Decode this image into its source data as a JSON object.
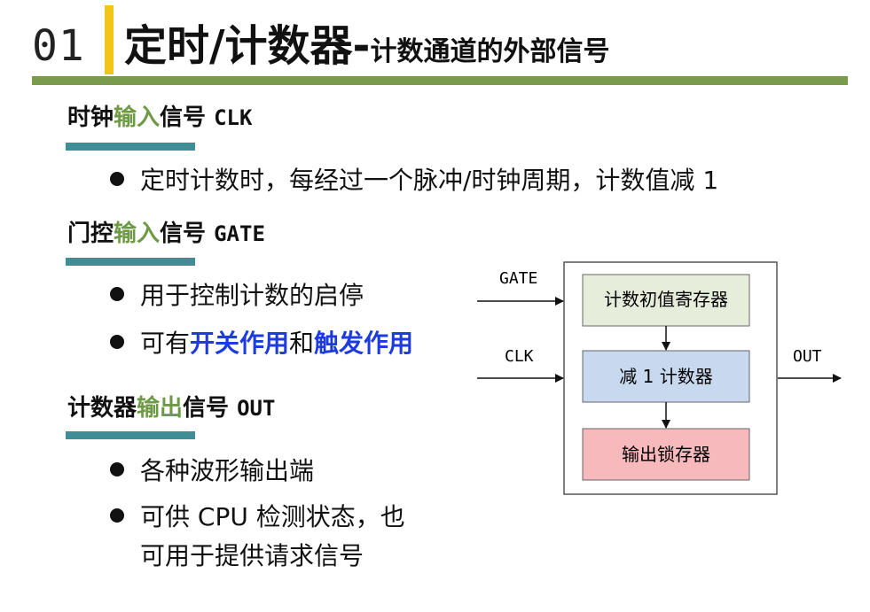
{
  "header": {
    "slide_number": "01",
    "title_main": "定时/计数器-",
    "title_sub": "计数通道的外部信号"
  },
  "sections": [
    {
      "head_pre": "时钟",
      "head_hl": "输入",
      "head_post": "信号",
      "head_code": "CLK",
      "bullets": [
        "定时计数时，每经过一个脉冲/时钟周期，计数值减 1"
      ]
    },
    {
      "head_pre": "门控",
      "head_hl": "输入",
      "head_post": "信号",
      "head_code": "GATE",
      "bullets": [
        "用于控制计数的启停"
      ],
      "bullet2": {
        "pre": "可有",
        "strong1": "开关作用",
        "mid": "和",
        "strong2": "触发作用"
      }
    },
    {
      "head_pre": "计数器",
      "head_hl": "输出",
      "head_post": "信号",
      "head_code": "OUT",
      "bullets": [
        "各种波形输出端",
        "可供 CPU 检测状态，也",
        "可用于提供请求信号"
      ]
    }
  ],
  "diagram": {
    "gate_label": "GATE",
    "clk_label": "CLK",
    "out_label": "OUT",
    "blocks": [
      {
        "label": "计数初值寄存器",
        "fill": "#e6eedb"
      },
      {
        "label": "减 1 计数器",
        "fill": "#c8d9ef"
      },
      {
        "label": "输出锁存器",
        "fill": "#f7b9bb"
      }
    ]
  },
  "colors": {
    "accent_yellow": "#f2c519",
    "rule_green": "#7a9b4b",
    "highlight_green": "#6f9a45",
    "section_rule_teal": "#3f8d95",
    "emphasis_blue": "#1e3be0"
  }
}
